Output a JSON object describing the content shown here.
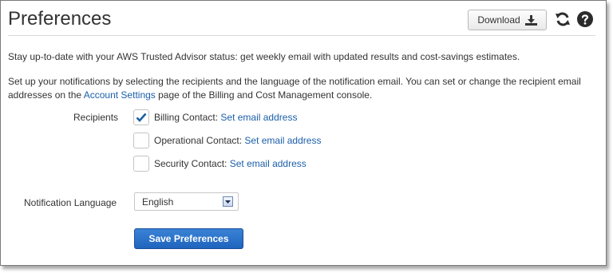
{
  "header": {
    "title": "Preferences",
    "download_label": "Download"
  },
  "icons": {
    "download": "download-icon",
    "refresh": "refresh-icon",
    "help": "help-icon"
  },
  "intro": {
    "text": "Stay up-to-date with your AWS Trusted Advisor status: get weekly email with updated results and cost-savings estimates."
  },
  "setup": {
    "text_before": "Set up your notifications by selecting the recipients and the language of the notification email. You can set or change the recipient email addresses on the ",
    "link": "Account Settings",
    "text_after": " page of the Billing and Cost Management console."
  },
  "recipients": {
    "label": "Recipients",
    "items": [
      {
        "name": "Billing Contact:",
        "link": "Set email address",
        "checked": true
      },
      {
        "name": "Operational Contact:",
        "link": "Set email address",
        "checked": false
      },
      {
        "name": "Security Contact:",
        "link": "Set email address",
        "checked": false
      }
    ]
  },
  "language": {
    "label": "Notification Language",
    "selected": "English"
  },
  "save_label": "Save Preferences",
  "colors": {
    "link": "#1b5faa",
    "primary_button": "#2a6fc9",
    "check": "#1b5faa"
  }
}
